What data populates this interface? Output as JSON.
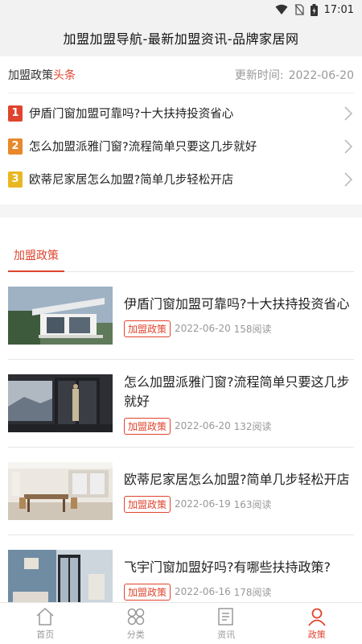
{
  "status": {
    "time": "17:01"
  },
  "app": {
    "title": "加盟加盟导航-最新加盟资讯-品牌家居网"
  },
  "headlines": {
    "title_main": "加盟政策",
    "title_accent": "头条",
    "update_label": "更新时间:",
    "update_date": "2022-06-20",
    "items": [
      {
        "rank": "1",
        "text": "伊盾门窗加盟可靠吗?十大扶持投资省心",
        "color": "#e0442e"
      },
      {
        "rank": "2",
        "text": "怎么加盟派雅门窗?流程简单只要这几步就好",
        "color": "#e8882b"
      },
      {
        "rank": "3",
        "text": "欧蒂尼家居怎么加盟?简单几步轻松开店",
        "color": "#e9b723"
      }
    ]
  },
  "policy": {
    "tab_label": "加盟政策",
    "articles": [
      {
        "title": "伊盾门窗加盟可靠吗?十大扶持投资省心",
        "tag": "加盟政策",
        "date": "2022-06-20",
        "reads": "158阅读"
      },
      {
        "title": "怎么加盟派雅门窗?流程简单只要这几步就好",
        "tag": "加盟政策",
        "date": "2022-06-20",
        "reads": "132阅读"
      },
      {
        "title": "欧蒂尼家居怎么加盟?简单几步轻松开店",
        "tag": "加盟政策",
        "date": "2022-06-19",
        "reads": "163阅读"
      },
      {
        "title": "飞宇门窗加盟好吗?有哪些扶持政策?",
        "tag": "加盟政策",
        "date": "2022-06-16",
        "reads": "178阅读"
      }
    ]
  },
  "nav": {
    "items": [
      {
        "label": "首页",
        "icon": "home-icon"
      },
      {
        "label": "分类",
        "icon": "category-icon"
      },
      {
        "label": "资讯",
        "icon": "news-icon"
      },
      {
        "label": "政策",
        "icon": "user-icon"
      }
    ],
    "active": "政策"
  },
  "colors": {
    "accent": "#e0442e"
  }
}
